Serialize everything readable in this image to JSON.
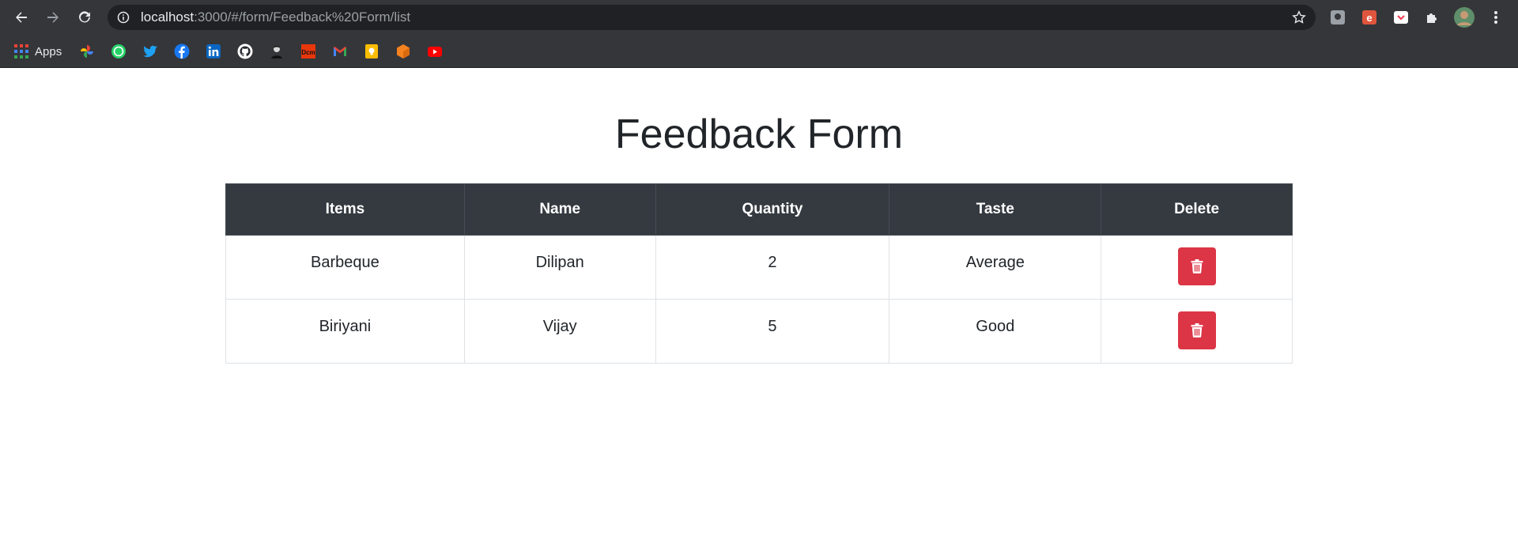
{
  "browser": {
    "url_host": "localhost",
    "url_path": ":3000/#/form/Feedback%20Form/list",
    "bookmarks": {
      "apps_label": "Apps",
      "icons": [
        "photos-icon",
        "whatsapp-icon",
        "twitter-icon",
        "facebook-icon",
        "linkedin-icon",
        "github-icon",
        "avatar-bookmark-icon",
        "pdf-tool-icon",
        "gmail-icon",
        "keep-icon",
        "box-icon",
        "youtube-icon"
      ]
    }
  },
  "page": {
    "title": "Feedback Form"
  },
  "table": {
    "headers": [
      "Items",
      "Name",
      "Quantity",
      "Taste",
      "Delete"
    ],
    "rows": [
      {
        "item": "Barbeque",
        "name": "Dilipan",
        "quantity": "2",
        "taste": "Average"
      },
      {
        "item": "Biriyani",
        "name": "Vijay",
        "quantity": "5",
        "taste": "Good"
      }
    ]
  },
  "colors": {
    "header_bg": "#343a40",
    "delete_button": "#dc3545",
    "chrome_bg": "#35363a"
  }
}
